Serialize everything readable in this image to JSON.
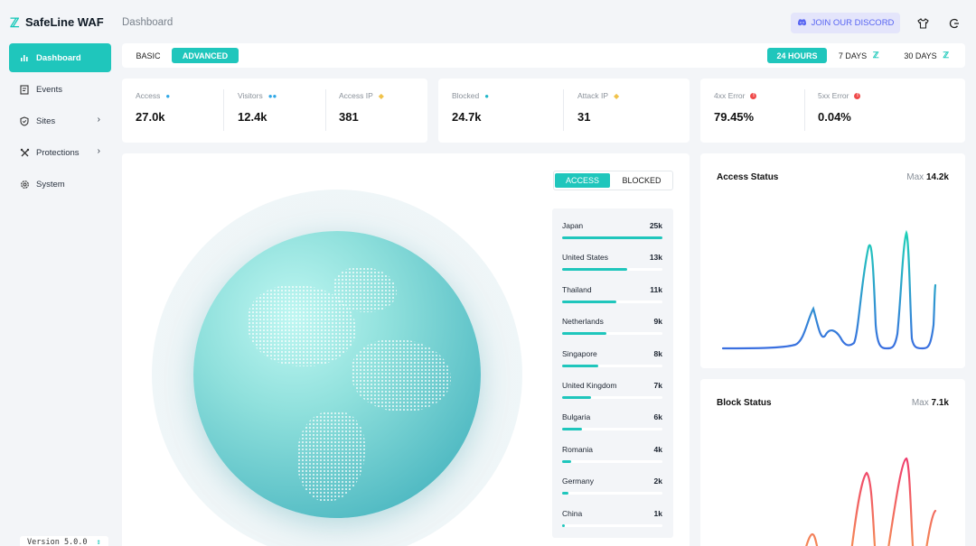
{
  "app": {
    "title": "SafeLine WAF",
    "version": "Version 5.0.0"
  },
  "sidebar": {
    "items": [
      {
        "label": "Dashboard",
        "icon": "bar-chart-icon",
        "active": true
      },
      {
        "label": "Events",
        "icon": "document-icon"
      },
      {
        "label": "Sites",
        "icon": "shield-icon",
        "chevron": true
      },
      {
        "label": "Protections",
        "icon": "tools-icon",
        "chevron": true
      },
      {
        "label": "System",
        "icon": "gear-icon"
      }
    ]
  },
  "header": {
    "title": "Dashboard",
    "discord_label": "JOIN OUR DISCORD"
  },
  "tabs": {
    "basic": "BASIC",
    "advanced": "ADVANCED",
    "h24": "24 HOURS",
    "d7": "7 DAYS",
    "d30": "30 DAYS"
  },
  "stats": {
    "access": {
      "label": "Access",
      "value": "27.0k"
    },
    "visitors": {
      "label": "Visitors",
      "value": "12.4k"
    },
    "access_ip": {
      "label": "Access IP",
      "value": "381"
    },
    "blocked": {
      "label": "Blocked",
      "value": "24.7k"
    },
    "attack_ip": {
      "label": "Attack IP",
      "value": "31"
    },
    "err4": {
      "label": "4xx Error",
      "value": "79.45%"
    },
    "err5": {
      "label": "5xx Error",
      "value": "0.04%"
    }
  },
  "map_toggle": {
    "access": "ACCESS",
    "blocked": "BLOCKED"
  },
  "countries": [
    {
      "name": "Japan",
      "value": "25k",
      "ratio": 1.0
    },
    {
      "name": "United States",
      "value": "13k",
      "ratio": 0.65
    },
    {
      "name": "Thailand",
      "value": "11k",
      "ratio": 0.54
    },
    {
      "name": "Netherlands",
      "value": "9k",
      "ratio": 0.44
    },
    {
      "name": "Singapore",
      "value": "8k",
      "ratio": 0.36
    },
    {
      "name": "United Kingdom",
      "value": "7k",
      "ratio": 0.29
    },
    {
      "name": "Bulgaria",
      "value": "6k",
      "ratio": 0.2
    },
    {
      "name": "Romania",
      "value": "4k",
      "ratio": 0.09
    },
    {
      "name": "Germany",
      "value": "2k",
      "ratio": 0.06
    },
    {
      "name": "China",
      "value": "1k",
      "ratio": 0.03
    }
  ],
  "access_status": {
    "title": "Access Status",
    "max_label": "Max",
    "max_value": "14.2k",
    "color_start": "#3a6fe0",
    "color_end": "#1fd0b8"
  },
  "block_status": {
    "title": "Block Status",
    "max_label": "Max",
    "max_value": "7.1k",
    "color_start": "#f59c50",
    "color_end": "#ef3d6e"
  }
}
